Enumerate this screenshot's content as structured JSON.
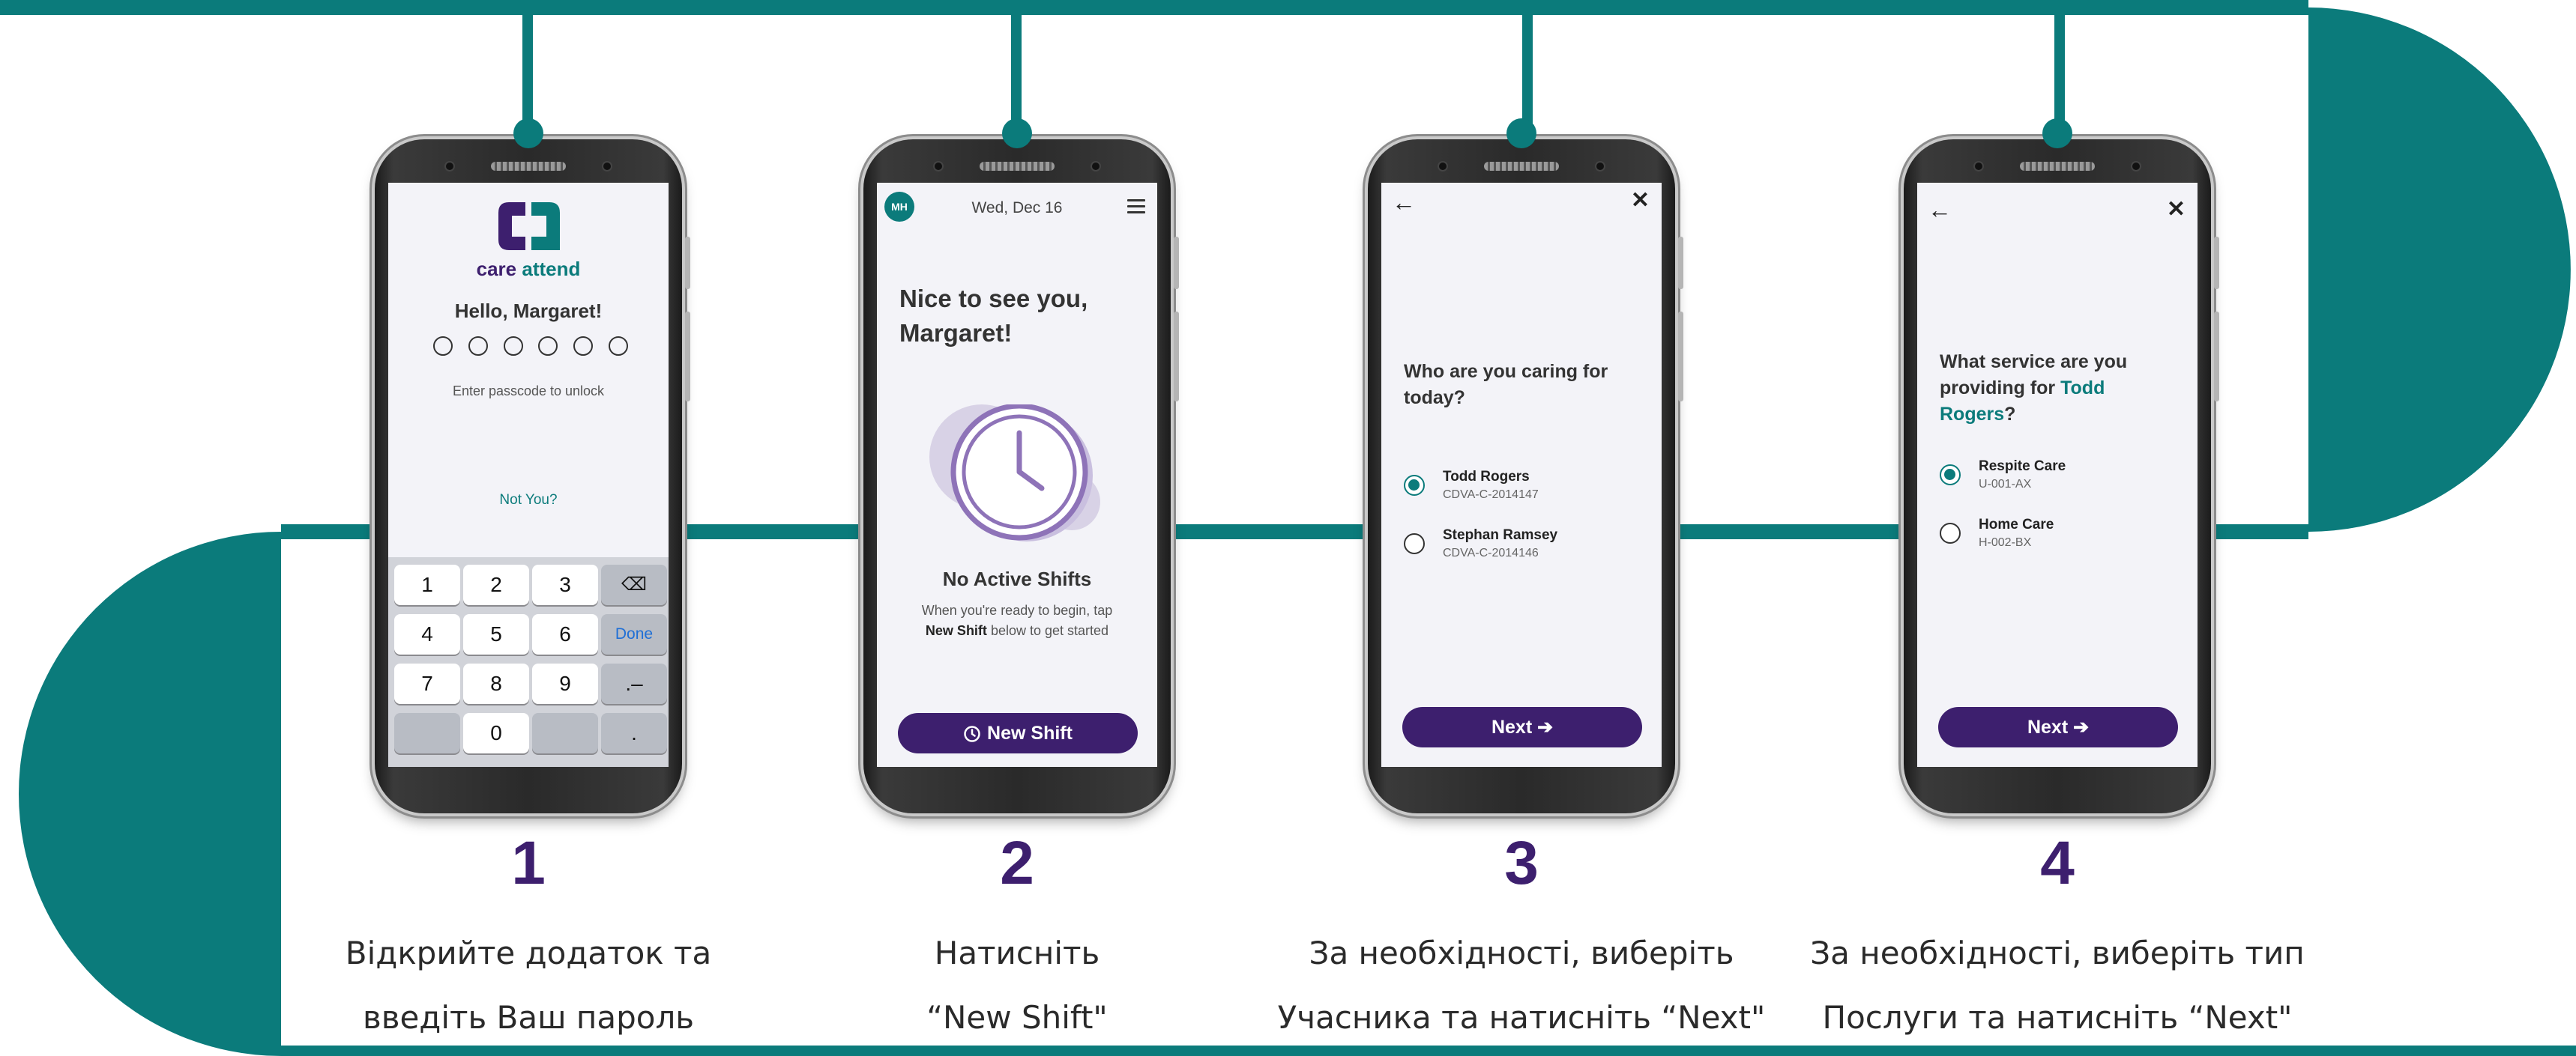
{
  "colors": {
    "teal": "#0b7b7b",
    "purple": "#3d1f6e",
    "text": "#2a2a2a"
  },
  "steps": [
    {
      "number": "1",
      "caption": {
        "line1": "Відкрийте додаток та",
        "line2": "введіть Ваш пароль"
      },
      "screen": {
        "brand": {
          "word1": "care",
          "word2": "attend"
        },
        "hello": "Hello, Margaret!",
        "hint": "Enter passcode to unlock",
        "not_you": "Not You?",
        "keys": [
          "1",
          "2",
          "3",
          "⌫",
          "4",
          "5",
          "6",
          "Done",
          "7",
          "8",
          "9",
          ".–",
          "",
          "0",
          "",
          "."
        ]
      }
    },
    {
      "number": "2",
      "caption": {
        "line1": "Натисніть",
        "line2": "“New Shift\""
      },
      "screen": {
        "avatar": "MH",
        "date": "Wed, Dec 16",
        "greeting": "Nice to see you, Margaret!",
        "empty_title": "No Active Shifts",
        "empty_sub_1": "When you're ready to begin, tap",
        "empty_sub_bold": "New Shift",
        "empty_sub_2": "below to get started",
        "button": "New Shift",
        "icons": [
          "clock-icon",
          "menu-icon"
        ]
      }
    },
    {
      "number": "3",
      "caption": {
        "line1": "За необхідності, виберіть",
        "line2": "Учасника та натисніть “Next\""
      },
      "screen": {
        "question": "Who are you caring for today?",
        "options": [
          {
            "name": "Todd Rogers",
            "code": "CDVA-C-2014147",
            "selected": true
          },
          {
            "name": "Stephan Ramsey",
            "code": "CDVA-C-2014146",
            "selected": false
          }
        ],
        "button": "Next"
      }
    },
    {
      "number": "4",
      "caption": {
        "line1": "За необхідності, виберіть тип",
        "line2": "Послуги та натисніть “Next\""
      },
      "screen": {
        "question_prefix": "What service are you providing for",
        "question_name": "Todd Rogers",
        "question_suffix": "?",
        "options": [
          {
            "name": "Respite Care",
            "code": "U-001-AX",
            "selected": true
          },
          {
            "name": "Home Care",
            "code": "H-002-BX",
            "selected": false
          }
        ],
        "button": "Next"
      }
    }
  ]
}
